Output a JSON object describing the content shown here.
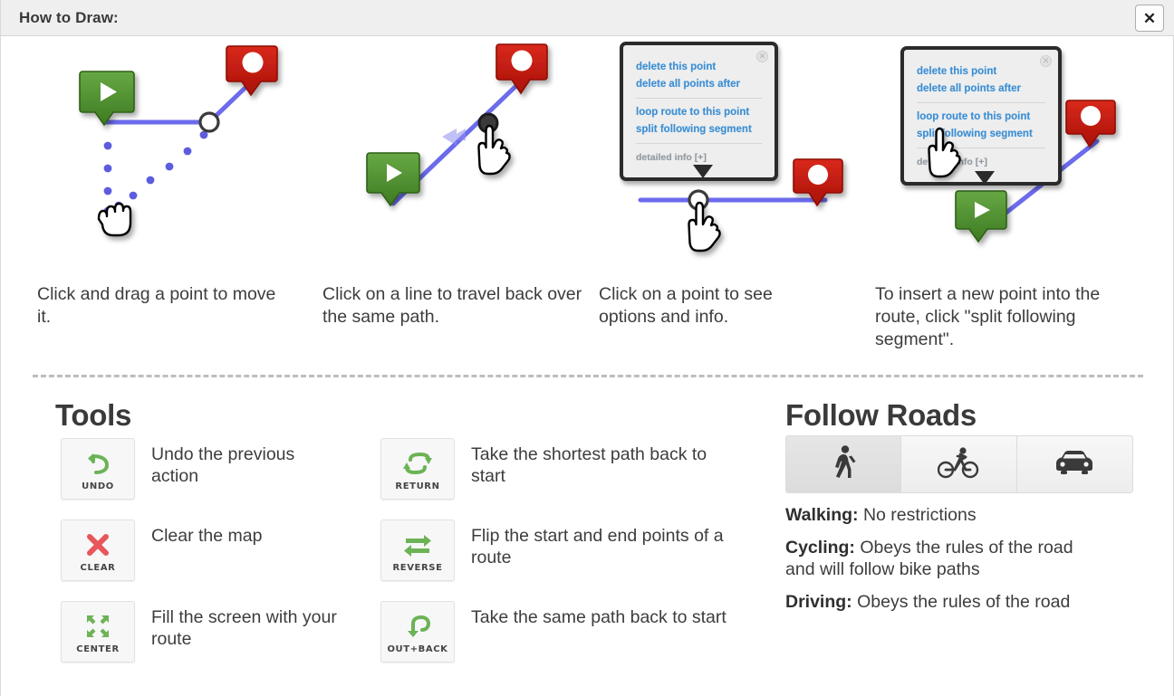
{
  "header": {
    "title": "How to Draw:",
    "close_label": "✕",
    "close_icon": "close-icon"
  },
  "steps": [
    {
      "id": "drag-point",
      "caption": "Click and drag a point to move it.",
      "icons": [
        "start-marker-icon",
        "end-marker-icon",
        "waypoint-circle-icon",
        "grab-hand-cursor-icon"
      ]
    },
    {
      "id": "click-line",
      "caption": "Click on a line to travel back over the same path.",
      "icons": [
        "start-marker-icon",
        "end-marker-icon",
        "waypoint-dot-icon",
        "pointing-hand-cursor-icon",
        "back-arrow-icon"
      ]
    },
    {
      "id": "click-point",
      "caption": "Click on a point to see options and info.",
      "icons": [
        "end-marker-icon",
        "waypoint-circle-icon",
        "pointing-hand-cursor-icon",
        "popup-icon"
      ]
    },
    {
      "id": "split-segment",
      "caption": "To insert a new point into the route, click \"split following segment\".",
      "icons": [
        "start-marker-icon",
        "end-marker-icon",
        "pointing-hand-cursor-icon",
        "popup-icon"
      ]
    }
  ],
  "popup": {
    "items": [
      "delete this point",
      "delete all points after",
      "loop route to this point",
      "split following segment"
    ],
    "detail_label": "detailed info [+]",
    "close_glyph": "✕",
    "link_color": "#3b8fd4"
  },
  "tools": {
    "title": "Tools",
    "items": [
      {
        "label": "UNDO",
        "icon": "undo-arrow-icon",
        "desc": "Undo the previous action",
        "color": "#6cb356"
      },
      {
        "label": "CLEAR",
        "icon": "x-cross-icon",
        "desc": "Clear the map",
        "color": "#e8565b"
      },
      {
        "label": "CENTER",
        "icon": "center-arrows-icon",
        "desc": "Fill the screen with your route",
        "color": "#6cb356"
      },
      {
        "label": "RETURN",
        "icon": "loop-arrows-icon",
        "desc": "Take the shortest path back to start",
        "color": "#6cb356"
      },
      {
        "label": "REVERSE",
        "icon": "swap-arrows-icon",
        "desc": "Flip the start and end points of a route",
        "color": "#6cb356"
      },
      {
        "label": "OUT+BACK",
        "icon": "out-and-back-arrow-icon",
        "desc": "Take the same path back to start",
        "color": "#6cb356"
      }
    ]
  },
  "follow_roads": {
    "title": "Follow Roads",
    "modes": [
      {
        "id": "walking",
        "icon": "walking-icon",
        "selected": true
      },
      {
        "id": "cycling",
        "icon": "cycling-icon",
        "selected": false
      },
      {
        "id": "driving",
        "icon": "car-icon",
        "selected": false
      }
    ],
    "descriptions": [
      {
        "term": "Walking:",
        "text": " No restrictions"
      },
      {
        "term": "Cycling:",
        "text": " Obeys the rules of the road and will follow bike paths"
      },
      {
        "term": "Driving:",
        "text": " Obeys the rules of the road"
      }
    ]
  },
  "colors": {
    "route_line": "#5c5ce0",
    "start_marker": "#4a8a2e",
    "end_marker": "#c4170c",
    "header_bg": "#efefef",
    "text": "#3d3d3d"
  }
}
